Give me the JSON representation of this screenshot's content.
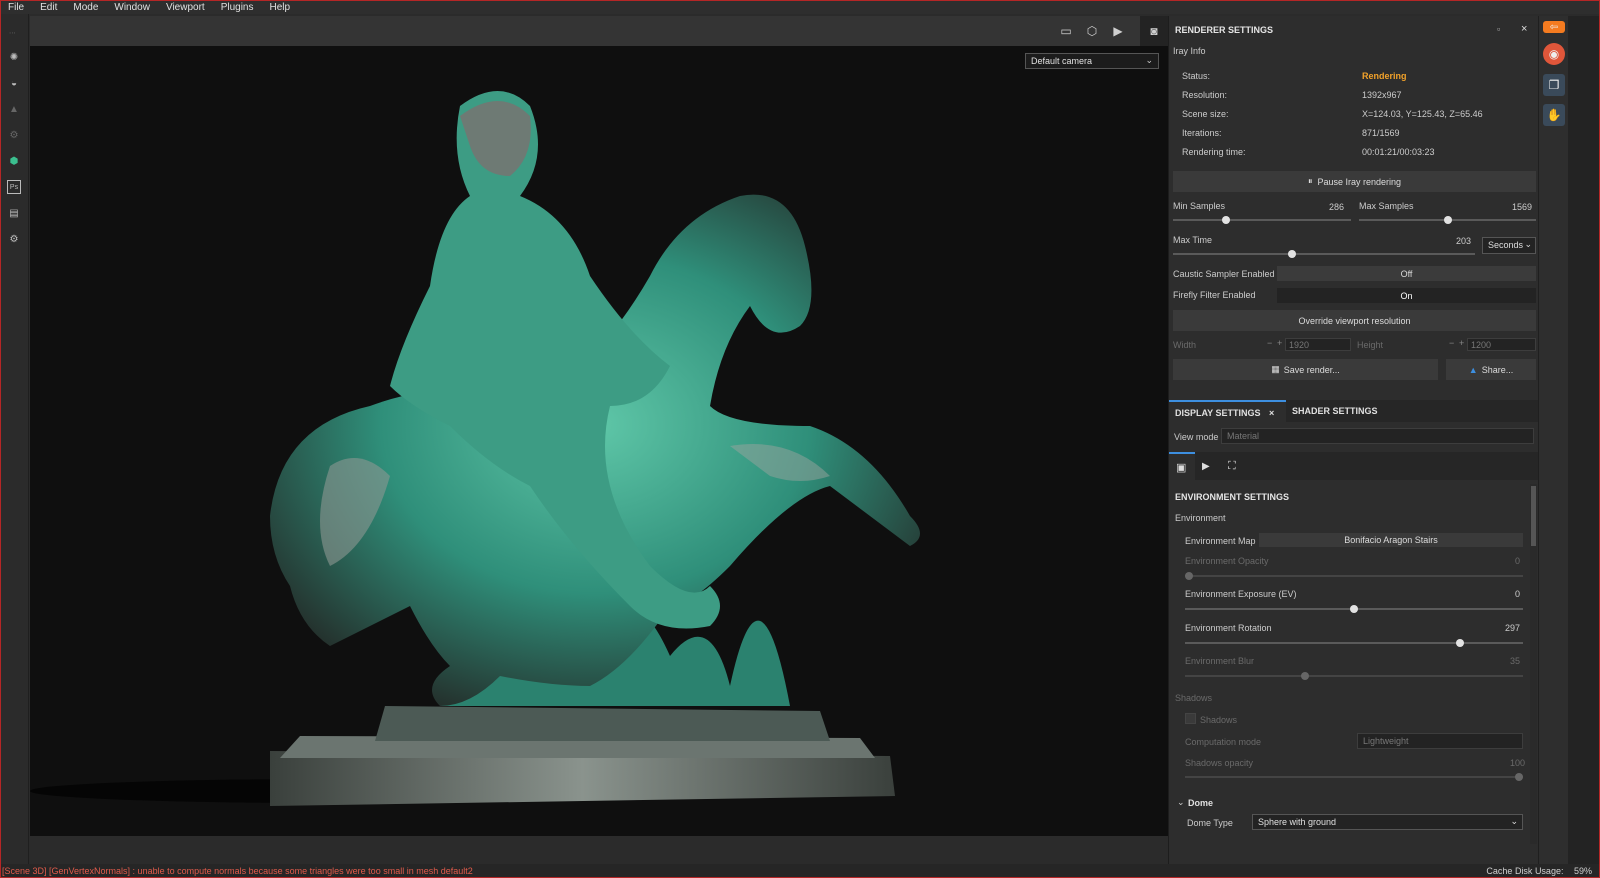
{
  "menu": [
    "File",
    "Edit",
    "Mode",
    "Window",
    "Viewport",
    "Plugins",
    "Help"
  ],
  "viewport": {
    "camera": "Default camera"
  },
  "renderer": {
    "title": "RENDERER SETTINGS",
    "iray_info_label": "Iray Info",
    "status_label": "Status:",
    "status_value": "Rendering",
    "resolution_label": "Resolution:",
    "resolution_value": "1392x967",
    "scene_size_label": "Scene size:",
    "scene_size_value": "X=124.03, Y=125.43, Z=65.46",
    "iterations_label": "Iterations:",
    "iterations_value": "871/1569",
    "time_label": "Rendering time:",
    "time_value": "00:01:21/00:03:23",
    "pause_button": "Pause Iray rendering",
    "min_samples_label": "Min Samples",
    "min_samples_value": "286",
    "max_samples_label": "Max Samples",
    "max_samples_value": "1569",
    "max_time_label": "Max Time",
    "max_time_value": "203",
    "time_unit": "Seconds",
    "caustic_label": "Caustic Sampler Enabled",
    "caustic_value": "Off",
    "firefly_label": "Firefly Filter Enabled",
    "firefly_value": "On",
    "override_button": "Override viewport resolution",
    "width_label": "Width",
    "width_value": "1920",
    "height_label": "Height",
    "height_value": "1200",
    "save_button": "Save render...",
    "share_button": "Share..."
  },
  "display": {
    "tab_display": "DISPLAY SETTINGS",
    "tab_shader": "SHADER SETTINGS",
    "view_mode_label": "View mode",
    "view_mode_value": "Material",
    "env_title": "ENVIRONMENT SETTINGS",
    "env_group": "Environment",
    "env_map_label": "Environment Map",
    "env_map_value": "Bonifacio Aragon Stairs",
    "env_opacity_label": "Environment Opacity",
    "env_opacity_value": "0",
    "env_exposure_label": "Environment Exposure (EV)",
    "env_exposure_value": "0",
    "env_rotation_label": "Environment Rotation",
    "env_rotation_value": "297",
    "env_blur_label": "Environment Blur",
    "env_blur_value": "35",
    "shadows_group": "Shadows",
    "shadows_check": "Shadows",
    "comp_mode_label": "Computation mode",
    "comp_mode_value": "Lightweight",
    "shadows_opacity_label": "Shadows opacity",
    "shadows_opacity_value": "100",
    "dome_label": "Dome",
    "dome_type_label": "Dome Type",
    "dome_type_value": "Sphere with ground"
  },
  "sliders": {
    "min_samples": 0.29,
    "max_samples": 0.5,
    "max_time": 0.39,
    "env_opacity": 0.0,
    "env_exposure": 0.5,
    "env_rotation": 0.82,
    "env_blur": 0.35,
    "shadows_opacity": 1.0
  },
  "status": {
    "error": "[Scene 3D] [GenVertexNormals] : unable to compute normals because some triangles were too small in mesh default2",
    "cache_label": "Cache Disk Usage:",
    "cache_value": "59%"
  },
  "colors": {
    "accent": "#3d8fe0",
    "rendering": "#f2a22a",
    "error": "#e25b4b",
    "statue": "#2f8f7a"
  }
}
